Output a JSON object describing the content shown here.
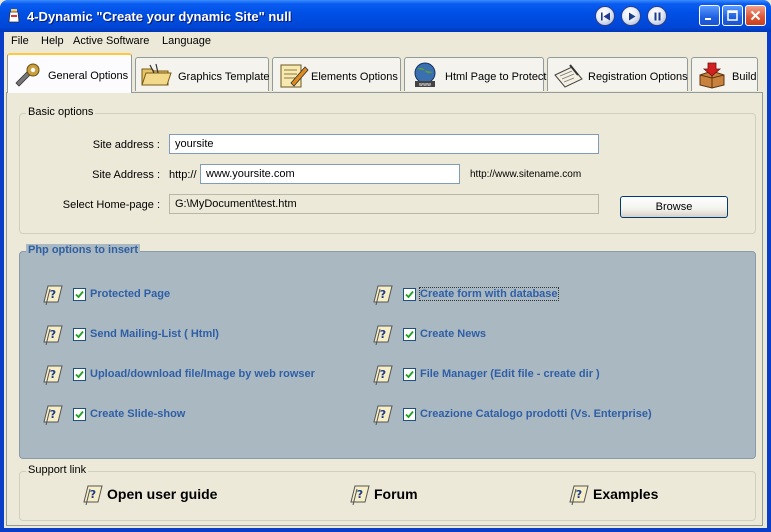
{
  "window": {
    "title": "4-Dynamic \"Create your dynamic Site\"   null"
  },
  "menu": [
    "File",
    "Help",
    "Active Software",
    "Language"
  ],
  "tabs": [
    {
      "label": "General Options",
      "icon": "gear-wrench-icon",
      "active": true
    },
    {
      "label": "Graphics Template",
      "icon": "open-folder-icon"
    },
    {
      "label": "Elements Options",
      "icon": "notepad-pencil-icon"
    },
    {
      "label": "Html Page to Protect",
      "icon": "globe-www-icon"
    },
    {
      "label": "Registration Options",
      "icon": "form-pen-icon"
    },
    {
      "label": "Build",
      "icon": "package-box-icon"
    }
  ],
  "basic": {
    "title": "Basic options",
    "site_address_label": "Site address :",
    "site_address_value": "yoursite",
    "site_url_label": "Site Address :",
    "site_url_prefix": "http://",
    "site_url_value": "www.yoursite.com",
    "site_url_hint": "http://www.sitename.com",
    "homepage_label": "Select Home-page :",
    "homepage_value": "G:\\MyDocument\\test.htm",
    "browse_label": "Browse"
  },
  "php": {
    "title": "Php options to insert",
    "options": [
      {
        "label": "Protected Page",
        "checked": true
      },
      {
        "label": "Create form with database",
        "checked": true
      },
      {
        "label": "Send Mailing-List ( Html)",
        "checked": true
      },
      {
        "label": "Create News",
        "checked": true
      },
      {
        "label": "Upload/download file/Image by web rowser",
        "checked": true
      },
      {
        "label": "File Manager (Edit file - create dir )",
        "checked": true
      },
      {
        "label": "Create Slide-show",
        "checked": true
      },
      {
        "label": "Creazione Catalogo prodotti (Vs.  Enterprise)",
        "checked": true
      }
    ]
  },
  "support": {
    "title": "Support link",
    "links": [
      "Open user guide",
      "Forum",
      "Examples"
    ]
  },
  "colors": {
    "titlebar": "#0050E6",
    "php_panel": "#AAB8C2",
    "option_text": "#2E5FA6",
    "dialog_bg": "#ECE9D8"
  }
}
